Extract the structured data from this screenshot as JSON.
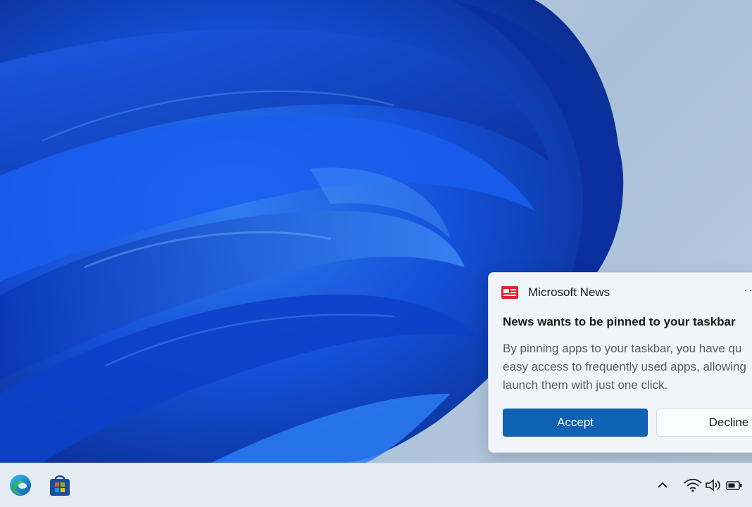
{
  "notification": {
    "app_name": "Microsoft News",
    "more_label": "··",
    "title": "News wants to be pinned to your taskbar",
    "body_lines": [
      "By pinning apps to your taskbar, you have qu",
      "easy access to frequently used apps, allowing",
      "launch them with just one click."
    ],
    "accept_label": "Accept",
    "decline_label": "Decline",
    "accent_color": "#0f62b4"
  },
  "taskbar": {
    "pinned_apps": [
      {
        "name": "Microsoft Edge",
        "icon": "edge-icon"
      },
      {
        "name": "Microsoft Store",
        "icon": "store-icon"
      }
    ],
    "tray_icons": [
      "chevron-up-icon",
      "wifi-icon",
      "volume-icon",
      "battery-icon"
    ],
    "overflow_glyph": "∧"
  }
}
